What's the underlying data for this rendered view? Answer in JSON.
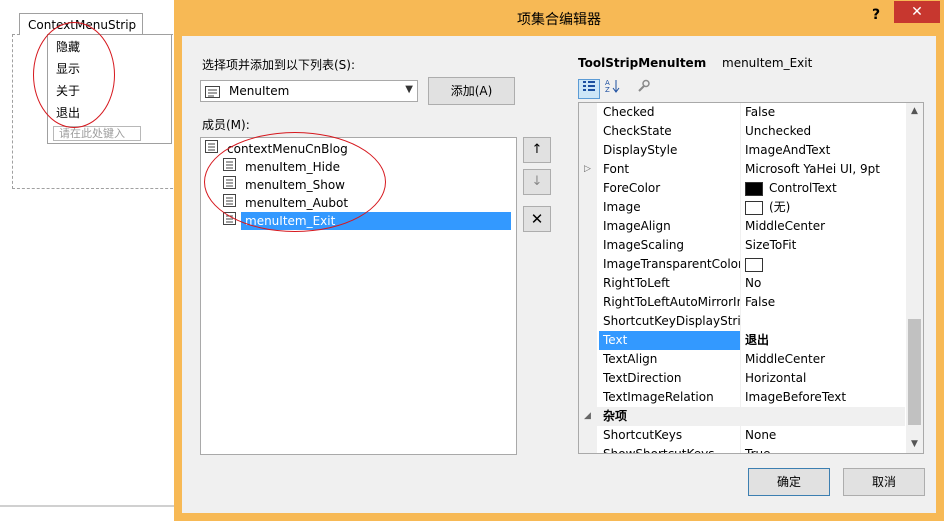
{
  "designer": {
    "tab_label": "ContextMenuStrip",
    "menu_items": [
      "隐藏",
      "显示",
      "关于",
      "退出"
    ],
    "type_here": "请在此处键入"
  },
  "dialog": {
    "title": "项集合编辑器",
    "help_label": "?",
    "close_label": "✕",
    "select_label": "选择项并添加到以下列表(S):",
    "combo_value": "MenuItem",
    "add_button": "添加(A)",
    "members_label": "成员(M):",
    "members": {
      "root": "contextMenuCnBlog",
      "items": [
        "menuItem_Hide",
        "menuItem_Show",
        "menuItem_Aubot",
        "menuItem_Exit"
      ],
      "selected_index": 3
    },
    "side_buttons": {
      "up": "↑",
      "down": "↓",
      "delete": "✕"
    },
    "properties": {
      "type_name": "ToolStripMenuItem",
      "object_name": "menuItem_Exit",
      "toolbar": {
        "categorized": "categorized-icon",
        "alphabetical": "sort-az-icon",
        "property_pages": "wrench-icon"
      },
      "rows": [
        {
          "name": "Checked",
          "value": "False"
        },
        {
          "name": "CheckState",
          "value": "Unchecked"
        },
        {
          "name": "DisplayStyle",
          "value": "ImageAndText"
        },
        {
          "name": "Font",
          "value": "Microsoft YaHei UI, 9pt",
          "expandable": true
        },
        {
          "name": "ForeColor",
          "value": "ControlText",
          "swatch": "#000000"
        },
        {
          "name": "Image",
          "value": "(无)",
          "swatch": "#ffffff"
        },
        {
          "name": "ImageAlign",
          "value": "MiddleCenter"
        },
        {
          "name": "ImageScaling",
          "value": "SizeToFit"
        },
        {
          "name": "ImageTransparentColor",
          "value": "",
          "swatch": "#ffffff"
        },
        {
          "name": "RightToLeft",
          "value": "No"
        },
        {
          "name": "RightToLeftAutoMirrorImage",
          "value": "False"
        },
        {
          "name": "ShortcutKeyDisplayString",
          "value": ""
        },
        {
          "name": "Text",
          "value": "退出",
          "selected": true
        },
        {
          "name": "TextAlign",
          "value": "MiddleCenter"
        },
        {
          "name": "TextDirection",
          "value": "Horizontal"
        },
        {
          "name": "TextImageRelation",
          "value": "ImageBeforeText"
        },
        {
          "name": "杂项",
          "value": "",
          "category": true
        },
        {
          "name": "ShortcutKeys",
          "value": "None"
        },
        {
          "name": "ShowShortcutKeys",
          "value": "True"
        }
      ]
    },
    "ok_button": "确定",
    "cancel_button": "取消"
  }
}
